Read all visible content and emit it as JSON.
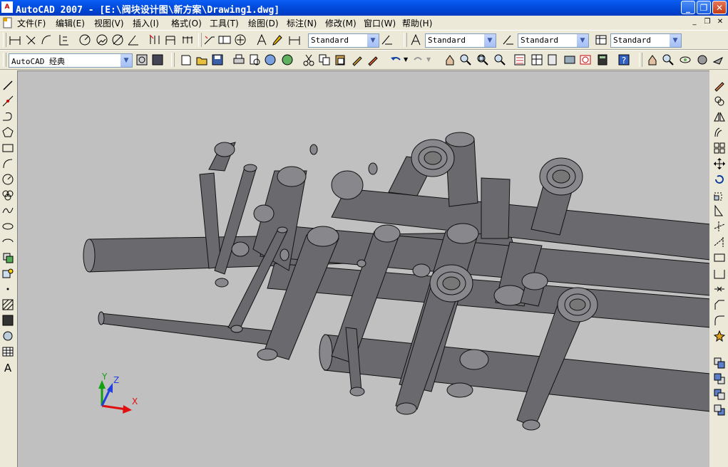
{
  "window": {
    "title": "AutoCAD 2007 - [E:\\阀块设计图\\新方案\\Drawing1.dwg]",
    "icon_label": "A",
    "buttons": [
      "minimize-icon",
      "restore-icon",
      "close-icon"
    ]
  },
  "menu": {
    "items": [
      "文件(F)",
      "编辑(E)",
      "视图(V)",
      "插入(I)",
      "格式(O)",
      "工具(T)",
      "绘图(D)",
      "标注(N)",
      "修改(M)",
      "窗口(W)",
      "帮助(H)"
    ]
  },
  "toolbar1": {
    "style_combos": [
      "Standard",
      "Standard",
      "Standard",
      "Standard"
    ]
  },
  "toolbar2": {
    "workspace": "AutoCAD 经典"
  },
  "ucs": {
    "x_label": "X",
    "y_label": "Y",
    "z_label": "Z"
  },
  "colors": {
    "titlebar": "#0a5ef5",
    "viewport_bg": "#c0c0c0",
    "cylinder": "#6a6a6e",
    "ucs_x": "#e01010",
    "ucs_y": "#10a010",
    "ucs_z": "#2040e0"
  }
}
